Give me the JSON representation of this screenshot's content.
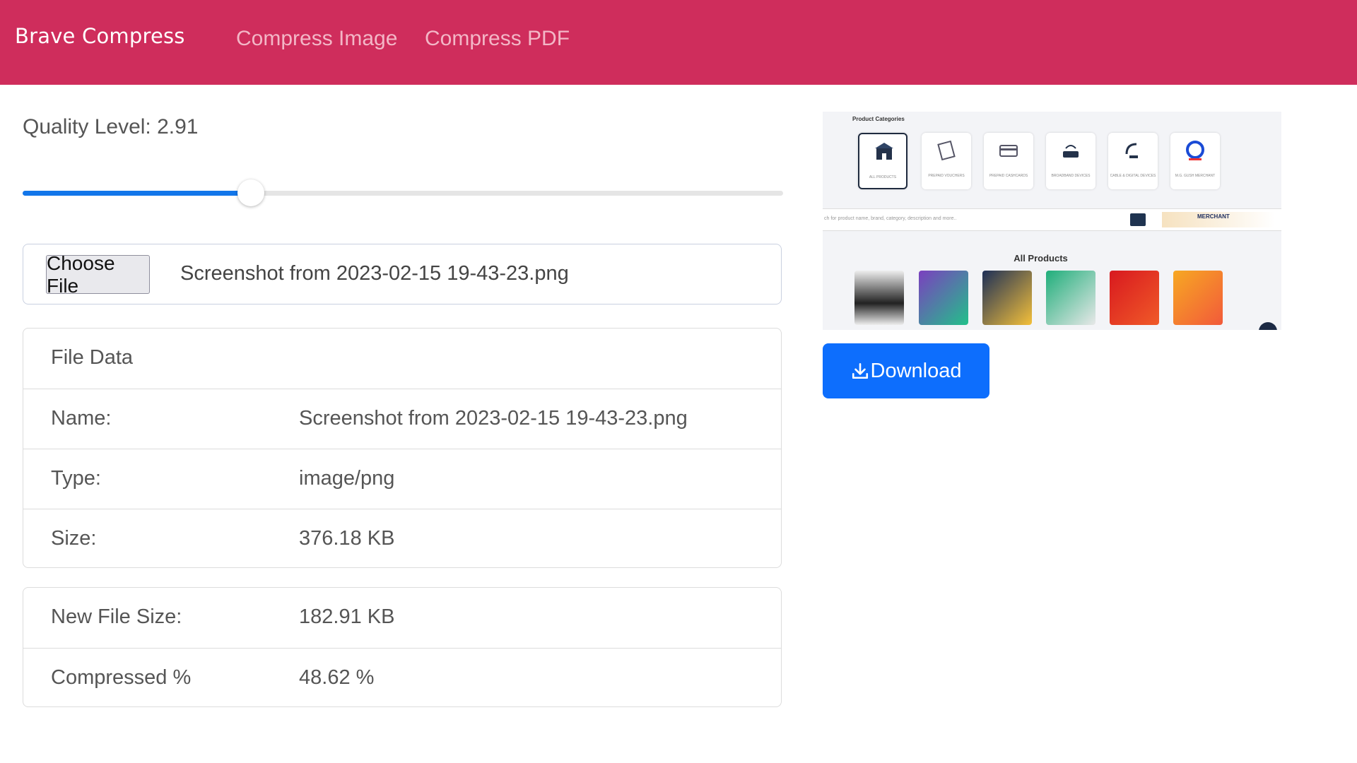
{
  "navbar": {
    "brand": "Brave Compress",
    "links": [
      "Compress Image",
      "Compress PDF"
    ],
    "bg_color": "#cf2d5c"
  },
  "quality": {
    "label": "Quality Level: 2.91",
    "slider_value_fraction": 0.3
  },
  "file_input": {
    "button_label": "Choose File",
    "file_name": "Screenshot from 2023-02-15 19-43-23.png"
  },
  "file_data": {
    "header": "File Data",
    "rows": [
      {
        "label": "Name:",
        "value": "Screenshot from 2023-02-15 19-43-23.png"
      },
      {
        "label": "Type:",
        "value": "image/png"
      },
      {
        "label": "Size:",
        "value": "376.18 KB"
      }
    ]
  },
  "result": {
    "rows": [
      {
        "label": "New File Size:",
        "value": "182.91 KB"
      },
      {
        "label": "Compressed %",
        "value": "48.62 %"
      }
    ]
  },
  "preview": {
    "categories_title": "Product Categories",
    "categories": [
      "ALL PRODUCTS",
      "PREPAID VOUCHERS",
      "PREPAID CASHCARDS",
      "BROADBAND DEVICES",
      "CABLE & DIGITAL DEVICES",
      "M.G. GUSH MERCHANT"
    ],
    "search_placeholder": "ch for product name, brand, category, description and more..",
    "merchant_banner": "MERCHANT",
    "all_products_title": "All Products"
  },
  "download_button": {
    "label": "Download",
    "color": "#0d6efd"
  }
}
